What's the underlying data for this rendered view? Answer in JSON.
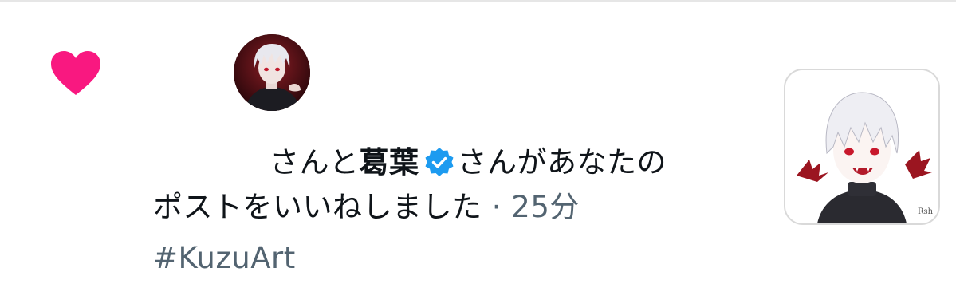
{
  "notification": {
    "type_icon": "heart-icon",
    "accent_color": "#f91880",
    "verified_color": "#1d9bf0",
    "avatars": [
      {
        "name": "hidden-user-avatar",
        "icon": "avatar"
      },
      {
        "name": "kuzuha-avatar",
        "icon": "avatar"
      }
    ],
    "text": {
      "prefix": "さんと",
      "user_name": "葛葉",
      "verified_icon": "verified-badge-icon",
      "line1_suffix": "さんがあなたの",
      "line2": "ポストをいいねしました",
      "time_sep": "·",
      "time": "25分"
    },
    "hashtag": "#KuzuArt",
    "post_thumbnail": {
      "icon": "post-image-thumbnail",
      "signature": "Rsh"
    }
  }
}
